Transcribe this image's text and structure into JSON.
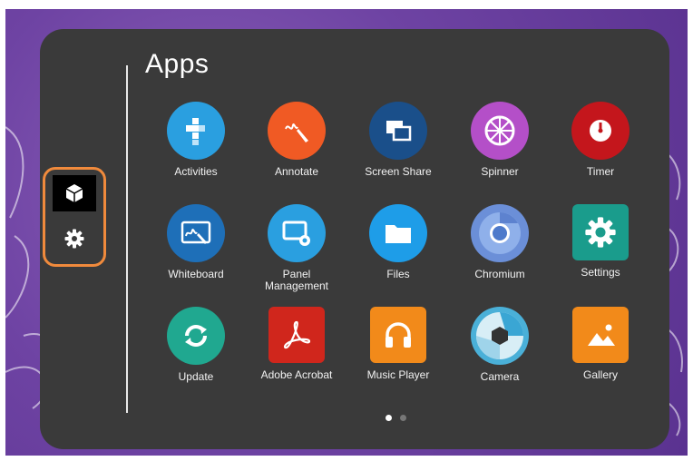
{
  "title": "Apps",
  "sidebar": {
    "items": [
      {
        "icon": "cube-icon",
        "active": true
      },
      {
        "icon": "gear-icon",
        "active": false
      }
    ],
    "highlight_color": "#f08a3c"
  },
  "apps": [
    {
      "label": "Activities",
      "icon": "puzzle-icon",
      "color": "#2a9fe0"
    },
    {
      "label": "Annotate",
      "icon": "pen-icon",
      "color": "#f05a24"
    },
    {
      "label": "Screen Share",
      "icon": "screen-share-icon",
      "color": "#1a4f8a"
    },
    {
      "label": "Spinner",
      "icon": "spinner-icon",
      "color": "#b44fc8"
    },
    {
      "label": "Timer",
      "icon": "timer-icon",
      "color": "#c4161c"
    },
    {
      "label": "Whiteboard",
      "icon": "whiteboard-icon",
      "color": "#1e6fb8"
    },
    {
      "label": "Panel\nManagement",
      "icon": "panel-management-icon",
      "color": "#2a9fe0"
    },
    {
      "label": "Files",
      "icon": "folder-icon",
      "color": "#1e9de8"
    },
    {
      "label": "Chromium",
      "icon": "chromium-icon",
      "color": "#6b8fd8"
    },
    {
      "label": "Settings",
      "icon": "gear-icon",
      "color": "#1a9c8c"
    },
    {
      "label": "Update",
      "icon": "refresh-icon",
      "color": "#20a890"
    },
    {
      "label": "Adobe Acrobat",
      "icon": "acrobat-icon",
      "color": "#d0261c"
    },
    {
      "label": "Music Player",
      "icon": "headphones-icon",
      "color": "#f28a1a"
    },
    {
      "label": "Camera",
      "icon": "camera-aperture-icon",
      "color": "#4ab0d8"
    },
    {
      "label": "Gallery",
      "icon": "image-icon",
      "color": "#f28a1a"
    }
  ],
  "pagination": {
    "current": 1,
    "total": 2
  }
}
